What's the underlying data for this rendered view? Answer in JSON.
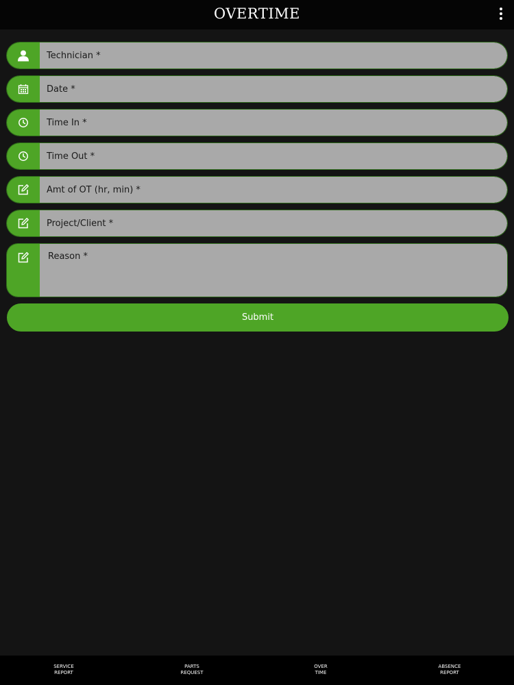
{
  "header": {
    "title": "OVERTIME",
    "menu_icon": "more-vertical-icon"
  },
  "form": {
    "fields": [
      {
        "placeholder": "Technician *",
        "icon": "user-icon"
      },
      {
        "placeholder": "Date *",
        "icon": "calendar-icon"
      },
      {
        "placeholder": "Time In *",
        "icon": "clock-icon"
      },
      {
        "placeholder": "Time Out *",
        "icon": "clock-icon"
      },
      {
        "placeholder": "Amt of OT (hr, min) *",
        "icon": "edit-icon"
      },
      {
        "placeholder": "Project/Client *",
        "icon": "edit-icon"
      },
      {
        "placeholder": "Reason *",
        "icon": "edit-icon"
      }
    ],
    "submit_label": "Submit"
  },
  "tabbar": {
    "items": [
      {
        "line1": "SERVICE",
        "line2": "REPORT"
      },
      {
        "line1": "PARTS",
        "line2": "REQUEST"
      },
      {
        "line1": "OVER",
        "line2": "TIME"
      },
      {
        "line1": "ABSENCE",
        "line2": "REPORT"
      }
    ]
  },
  "colors": {
    "accent": "#4ea526",
    "field_bg": "#a9a9a9",
    "background": "#141414",
    "header_bg": "#050505"
  }
}
